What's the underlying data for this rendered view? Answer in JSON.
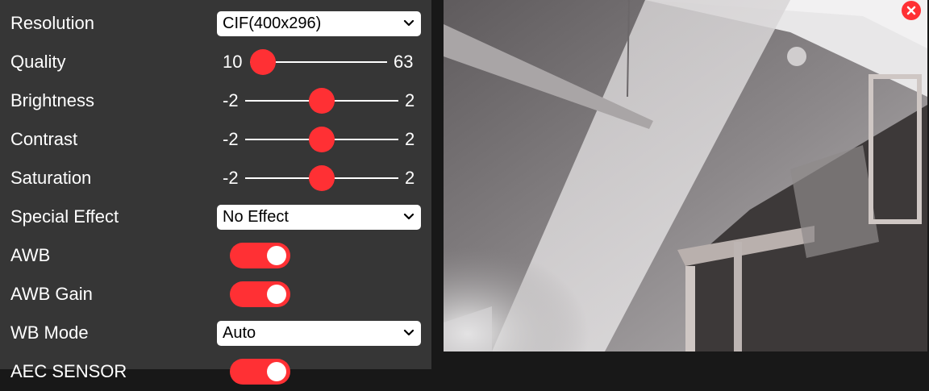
{
  "settings": {
    "resolution": {
      "label": "Resolution",
      "selected": "CIF(400x296)"
    },
    "quality": {
      "label": "Quality",
      "min": "10",
      "max": "63",
      "value": 10
    },
    "brightness": {
      "label": "Brightness",
      "min": "-2",
      "max": "2",
      "value": 0
    },
    "contrast": {
      "label": "Contrast",
      "min": "-2",
      "max": "2",
      "value": 0
    },
    "saturation": {
      "label": "Saturation",
      "min": "-2",
      "max": "2",
      "value": 0
    },
    "special_effect": {
      "label": "Special Effect",
      "selected": "No Effect"
    },
    "awb": {
      "label": "AWB",
      "on": true
    },
    "awb_gain": {
      "label": "AWB Gain",
      "on": true
    },
    "wb_mode": {
      "label": "WB Mode",
      "selected": "Auto"
    },
    "aec_sensor": {
      "label": "AEC SENSOR",
      "on": true
    }
  },
  "colors": {
    "accent": "#ff3034",
    "panel_bg": "#363636",
    "page_bg": "#181818"
  },
  "icons": {
    "close": "close-icon",
    "dropdown": "chevron-down-icon"
  }
}
